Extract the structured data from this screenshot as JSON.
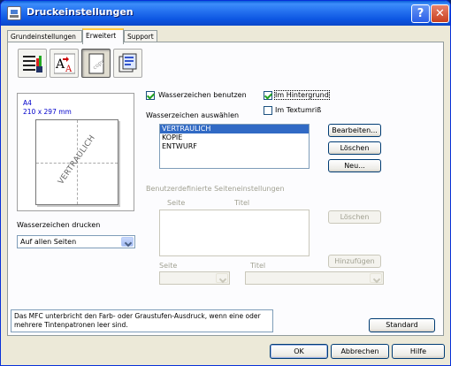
{
  "window": {
    "title": "Druckeinstellungen"
  },
  "titlebar_buttons": {
    "help": "?",
    "close": "✕"
  },
  "tabs": [
    {
      "label": "Grundeinstellungen",
      "active": false
    },
    {
      "label": "Erweitert",
      "active": true
    },
    {
      "label": "Support",
      "active": false
    }
  ],
  "icon_toolbar": [
    {
      "name": "color-settings-icon",
      "pressed": false
    },
    {
      "name": "font-scaling-icon",
      "pressed": false
    },
    {
      "name": "watermark-icon",
      "pressed": true
    },
    {
      "name": "page-options-icon",
      "pressed": false
    }
  ],
  "preview": {
    "paper_name": "A4",
    "paper_dims": "210 x 297 mm",
    "watermark_text": "VERTRAULICH"
  },
  "watermark_print": {
    "label": "Wasserzeichen drucken",
    "selected": "Auf allen Seiten"
  },
  "use_watermark": {
    "label": "Wasserzeichen benutzen",
    "checked": true
  },
  "in_background": {
    "label": "Im Hintergrund",
    "checked": true
  },
  "outline_text": {
    "label": "Im Textumriß",
    "checked": false
  },
  "select_watermark": {
    "label": "Wasserzeichen auswählen",
    "items": [
      "VERTRAULICH",
      "KOPIE",
      "ENTWURF"
    ],
    "selected_index": 0
  },
  "buttons": {
    "edit": "Bearbeiten...",
    "delete": "Löschen",
    "new": "Neu...",
    "custom_delete": "Löschen",
    "custom_add": "Hinzufügen",
    "standard": "Standard",
    "ok": "OK",
    "cancel": "Abbrechen",
    "help": "Hilfe"
  },
  "custom_pages": {
    "group_label": "Benutzerdefinierte Seiteneinstellungen",
    "col_page": "Seite",
    "col_title": "Titel",
    "page_label": "Seite",
    "title_label": "Titel"
  },
  "info_text": "Das MFC unterbricht den Farb- oder Graustufen-Ausdruck, wenn eine oder mehrere Tintenpatronen leer sind."
}
